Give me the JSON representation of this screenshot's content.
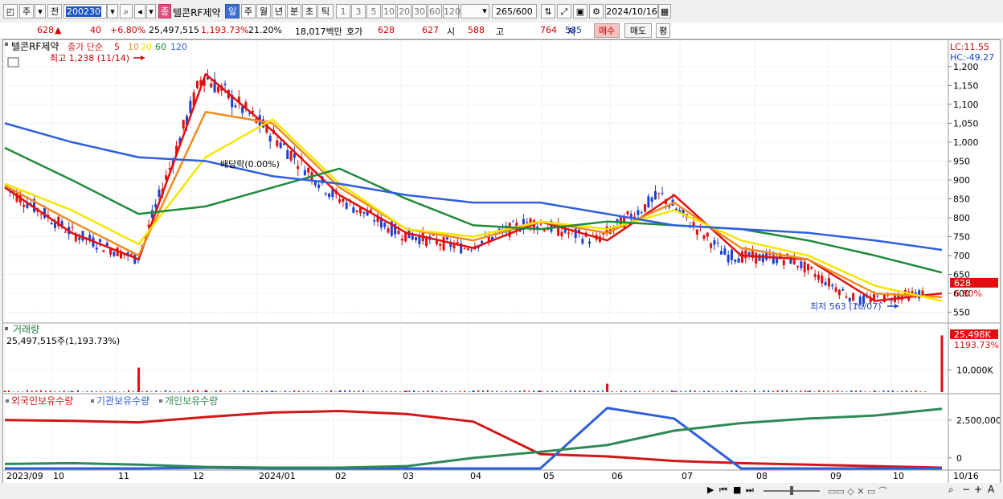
{
  "toolbar": {
    "btn_jong": "주",
    "btn_jeon": "전",
    "stock_code": "200230",
    "stock_badge": "종",
    "stock_name": "텔콘RF제약",
    "periods": [
      "일",
      "주",
      "월",
      "년",
      "분",
      "초",
      "틱"
    ],
    "active_period": "일",
    "intervals": [
      "1",
      "3",
      "5",
      "10",
      "20",
      "30",
      "60",
      "120"
    ],
    "count": "265",
    "count_total": "/600",
    "date": "2024/10/16"
  },
  "quote": {
    "price": "628",
    "change_arrow": "▲",
    "change": "40",
    "change_pct": "+6.80%",
    "volume": "25,497,515",
    "volume_pct": "1,193.73%",
    "turnover": "21.20%",
    "amount": "18,017백만",
    "bid_label": "호가",
    "ask": "628",
    "bid": "627",
    "open_label": "시",
    "open": "588",
    "high_label": "고",
    "high": "764",
    "low_label": "저",
    "low": "585",
    "buy_button": "매수",
    "sell_button": "매도",
    "eval_button": "평"
  },
  "price_panel": {
    "title_stock": "텔콘RF제약",
    "title_ma": "종가 단순",
    "ma_labels": [
      "5",
      "10",
      "20",
      "60",
      "120"
    ],
    "lc": "LC:11.55",
    "hc": "HC:-49.27",
    "last_price_tag": "628",
    "last_pct_tag": "6.80%",
    "max_annotation": "최고 1,238 (11/14)",
    "min_annotation": "최저 563 (10/07)",
    "dividend_annotation": "배당락(0.00%)"
  },
  "volume_panel": {
    "title": "거래량",
    "subtitle": "25,497,515주(1,193.73%)",
    "last_tag": "25,498K",
    "last_pct_tag": "1193.73%",
    "axis_label": "10,000K"
  },
  "holding_panel": {
    "legend": [
      "외국인보유수량",
      "기관보유수량",
      "개인보유수량"
    ],
    "axis_labels": [
      "2,500,000",
      "0"
    ]
  },
  "x_axis": {
    "labels": [
      "2023/09",
      "10",
      "11",
      "12",
      "2024/01",
      "02",
      "03",
      "04",
      "05",
      "06",
      "07",
      "08",
      "09",
      "10",
      "10/16"
    ]
  },
  "colors": {
    "ma5": "#e01010",
    "ma10": "#f08c1e",
    "ma20": "#f5e600",
    "ma60": "#1f8a3a",
    "ma120": "#2f5fe0",
    "up": "#e01010",
    "down": "#1f3fd0",
    "foreign": "#d01818",
    "institution": "#2e5ed8",
    "individual": "#2e8a55"
  },
  "chart_data": [
    {
      "type": "line",
      "title": "텔콘RF제약 종가 단순",
      "x": [
        "2023/09",
        "10",
        "11",
        "12",
        "2024/01",
        "02",
        "03",
        "04",
        "05",
        "06",
        "07",
        "08",
        "09",
        "10",
        "10/16"
      ],
      "ylim": [
        530,
        1240
      ],
      "yticks": [
        550,
        600,
        650,
        700,
        750,
        800,
        850,
        900,
        950,
        1000,
        1050,
        1100,
        1150,
        1200
      ],
      "series": [
        {
          "name": "5",
          "values": [
            880,
            760,
            690,
            1180,
            1030,
            860,
            760,
            720,
            790,
            740,
            860,
            700,
            690,
            580,
            600
          ]
        },
        {
          "name": "10",
          "values": [
            885,
            790,
            700,
            1080,
            1050,
            880,
            770,
            740,
            790,
            760,
            840,
            720,
            690,
            600,
            590
          ]
        },
        {
          "name": "20",
          "values": [
            890,
            820,
            730,
            960,
            1060,
            890,
            770,
            750,
            790,
            770,
            820,
            740,
            700,
            620,
            580
          ]
        },
        {
          "name": "60",
          "values": [
            985,
            900,
            810,
            830,
            880,
            930,
            850,
            780,
            770,
            790,
            780,
            770,
            740,
            700,
            655
          ]
        },
        {
          "name": "120",
          "values": [
            1050,
            1000,
            960,
            950,
            910,
            890,
            860,
            840,
            840,
            810,
            780,
            770,
            760,
            740,
            715
          ]
        }
      ],
      "last": 628,
      "max": {
        "value": 1238,
        "date": "11/14"
      },
      "min": {
        "value": 563,
        "date": "10/07"
      }
    },
    {
      "type": "bar",
      "title": "거래량",
      "categories": [
        "2023/09",
        "10",
        "11",
        "12",
        "2024/01",
        "02",
        "03",
        "04",
        "05",
        "06",
        "07",
        "08",
        "09",
        "10",
        "10/16"
      ],
      "values_k": [
        600,
        500,
        11000,
        800,
        500,
        400,
        600,
        700,
        700,
        3800,
        500,
        400,
        400,
        400,
        25498
      ],
      "ylabel": "10,000K"
    },
    {
      "type": "line",
      "title": "보유수량",
      "x": [
        "2023/09",
        "10",
        "11",
        "12",
        "2024/01",
        "02",
        "03",
        "04",
        "05",
        "06",
        "07",
        "08",
        "09",
        "10",
        "10/16"
      ],
      "ylim": [
        -700000,
        3500000
      ],
      "series": [
        {
          "name": "외국인보유수량",
          "values": [
            2500000,
            2450000,
            2350000,
            2700000,
            3000000,
            3100000,
            2900000,
            2400000,
            250000,
            100000,
            -200000,
            -350000,
            -450000,
            -550000,
            -650000
          ]
        },
        {
          "name": "기관보유수량",
          "values": [
            -700000,
            -700000,
            -700000,
            -650000,
            -700000,
            -700000,
            -700000,
            -700000,
            -700000,
            3300000,
            2600000,
            -700000,
            -700000,
            -700000,
            -700000
          ]
        },
        {
          "name": "개인보유수량",
          "values": [
            -400000,
            -350000,
            -450000,
            -600000,
            -650000,
            -650000,
            -550000,
            0,
            400000,
            850000,
            1800000,
            2300000,
            2600000,
            2800000,
            3250000
          ]
        }
      ]
    }
  ]
}
